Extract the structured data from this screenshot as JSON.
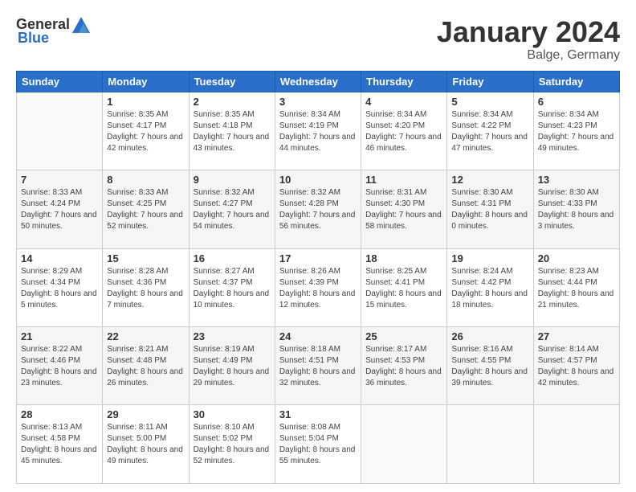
{
  "logo": {
    "general": "General",
    "blue": "Blue"
  },
  "title": "January 2024",
  "location": "Balge, Germany",
  "weekdays": [
    "Sunday",
    "Monday",
    "Tuesday",
    "Wednesday",
    "Thursday",
    "Friday",
    "Saturday"
  ],
  "weeks": [
    [
      {
        "day": "",
        "sunrise": "",
        "sunset": "",
        "daylight": ""
      },
      {
        "day": "1",
        "sunrise": "Sunrise: 8:35 AM",
        "sunset": "Sunset: 4:17 PM",
        "daylight": "Daylight: 7 hours and 42 minutes."
      },
      {
        "day": "2",
        "sunrise": "Sunrise: 8:35 AM",
        "sunset": "Sunset: 4:18 PM",
        "daylight": "Daylight: 7 hours and 43 minutes."
      },
      {
        "day": "3",
        "sunrise": "Sunrise: 8:34 AM",
        "sunset": "Sunset: 4:19 PM",
        "daylight": "Daylight: 7 hours and 44 minutes."
      },
      {
        "day": "4",
        "sunrise": "Sunrise: 8:34 AM",
        "sunset": "Sunset: 4:20 PM",
        "daylight": "Daylight: 7 hours and 46 minutes."
      },
      {
        "day": "5",
        "sunrise": "Sunrise: 8:34 AM",
        "sunset": "Sunset: 4:22 PM",
        "daylight": "Daylight: 7 hours and 47 minutes."
      },
      {
        "day": "6",
        "sunrise": "Sunrise: 8:34 AM",
        "sunset": "Sunset: 4:23 PM",
        "daylight": "Daylight: 7 hours and 49 minutes."
      }
    ],
    [
      {
        "day": "7",
        "sunrise": "Sunrise: 8:33 AM",
        "sunset": "Sunset: 4:24 PM",
        "daylight": "Daylight: 7 hours and 50 minutes."
      },
      {
        "day": "8",
        "sunrise": "Sunrise: 8:33 AM",
        "sunset": "Sunset: 4:25 PM",
        "daylight": "Daylight: 7 hours and 52 minutes."
      },
      {
        "day": "9",
        "sunrise": "Sunrise: 8:32 AM",
        "sunset": "Sunset: 4:27 PM",
        "daylight": "Daylight: 7 hours and 54 minutes."
      },
      {
        "day": "10",
        "sunrise": "Sunrise: 8:32 AM",
        "sunset": "Sunset: 4:28 PM",
        "daylight": "Daylight: 7 hours and 56 minutes."
      },
      {
        "day": "11",
        "sunrise": "Sunrise: 8:31 AM",
        "sunset": "Sunset: 4:30 PM",
        "daylight": "Daylight: 7 hours and 58 minutes."
      },
      {
        "day": "12",
        "sunrise": "Sunrise: 8:30 AM",
        "sunset": "Sunset: 4:31 PM",
        "daylight": "Daylight: 8 hours and 0 minutes."
      },
      {
        "day": "13",
        "sunrise": "Sunrise: 8:30 AM",
        "sunset": "Sunset: 4:33 PM",
        "daylight": "Daylight: 8 hours and 3 minutes."
      }
    ],
    [
      {
        "day": "14",
        "sunrise": "Sunrise: 8:29 AM",
        "sunset": "Sunset: 4:34 PM",
        "daylight": "Daylight: 8 hours and 5 minutes."
      },
      {
        "day": "15",
        "sunrise": "Sunrise: 8:28 AM",
        "sunset": "Sunset: 4:36 PM",
        "daylight": "Daylight: 8 hours and 7 minutes."
      },
      {
        "day": "16",
        "sunrise": "Sunrise: 8:27 AM",
        "sunset": "Sunset: 4:37 PM",
        "daylight": "Daylight: 8 hours and 10 minutes."
      },
      {
        "day": "17",
        "sunrise": "Sunrise: 8:26 AM",
        "sunset": "Sunset: 4:39 PM",
        "daylight": "Daylight: 8 hours and 12 minutes."
      },
      {
        "day": "18",
        "sunrise": "Sunrise: 8:25 AM",
        "sunset": "Sunset: 4:41 PM",
        "daylight": "Daylight: 8 hours and 15 minutes."
      },
      {
        "day": "19",
        "sunrise": "Sunrise: 8:24 AM",
        "sunset": "Sunset: 4:42 PM",
        "daylight": "Daylight: 8 hours and 18 minutes."
      },
      {
        "day": "20",
        "sunrise": "Sunrise: 8:23 AM",
        "sunset": "Sunset: 4:44 PM",
        "daylight": "Daylight: 8 hours and 21 minutes."
      }
    ],
    [
      {
        "day": "21",
        "sunrise": "Sunrise: 8:22 AM",
        "sunset": "Sunset: 4:46 PM",
        "daylight": "Daylight: 8 hours and 23 minutes."
      },
      {
        "day": "22",
        "sunrise": "Sunrise: 8:21 AM",
        "sunset": "Sunset: 4:48 PM",
        "daylight": "Daylight: 8 hours and 26 minutes."
      },
      {
        "day": "23",
        "sunrise": "Sunrise: 8:19 AM",
        "sunset": "Sunset: 4:49 PM",
        "daylight": "Daylight: 8 hours and 29 minutes."
      },
      {
        "day": "24",
        "sunrise": "Sunrise: 8:18 AM",
        "sunset": "Sunset: 4:51 PM",
        "daylight": "Daylight: 8 hours and 32 minutes."
      },
      {
        "day": "25",
        "sunrise": "Sunrise: 8:17 AM",
        "sunset": "Sunset: 4:53 PM",
        "daylight": "Daylight: 8 hours and 36 minutes."
      },
      {
        "day": "26",
        "sunrise": "Sunrise: 8:16 AM",
        "sunset": "Sunset: 4:55 PM",
        "daylight": "Daylight: 8 hours and 39 minutes."
      },
      {
        "day": "27",
        "sunrise": "Sunrise: 8:14 AM",
        "sunset": "Sunset: 4:57 PM",
        "daylight": "Daylight: 8 hours and 42 minutes."
      }
    ],
    [
      {
        "day": "28",
        "sunrise": "Sunrise: 8:13 AM",
        "sunset": "Sunset: 4:58 PM",
        "daylight": "Daylight: 8 hours and 45 minutes."
      },
      {
        "day": "29",
        "sunrise": "Sunrise: 8:11 AM",
        "sunset": "Sunset: 5:00 PM",
        "daylight": "Daylight: 8 hours and 49 minutes."
      },
      {
        "day": "30",
        "sunrise": "Sunrise: 8:10 AM",
        "sunset": "Sunset: 5:02 PM",
        "daylight": "Daylight: 8 hours and 52 minutes."
      },
      {
        "day": "31",
        "sunrise": "Sunrise: 8:08 AM",
        "sunset": "Sunset: 5:04 PM",
        "daylight": "Daylight: 8 hours and 55 minutes."
      },
      {
        "day": "",
        "sunrise": "",
        "sunset": "",
        "daylight": ""
      },
      {
        "day": "",
        "sunrise": "",
        "sunset": "",
        "daylight": ""
      },
      {
        "day": "",
        "sunrise": "",
        "sunset": "",
        "daylight": ""
      }
    ]
  ]
}
